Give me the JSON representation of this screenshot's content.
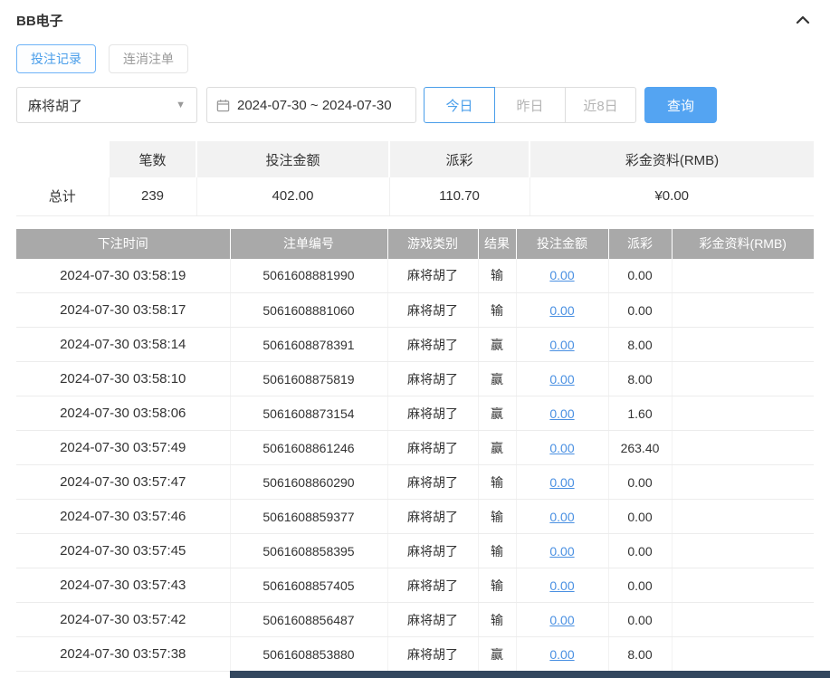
{
  "page": {
    "title": "BB电子"
  },
  "colors": {
    "accent": "#4a9eea",
    "search_button_bg": "#54a4f2",
    "table_header_bg": "#a9a9a9",
    "summary_header_bg": "#f2f2f2",
    "link": "#4a90e2",
    "bottom_bar": "#33475f"
  },
  "tabs": [
    {
      "label": "投注记录",
      "active": true
    },
    {
      "label": "连消注单",
      "active": false
    }
  ],
  "filters": {
    "game_select_value": "麻将胡了",
    "date_range": "2024-07-30 ~ 2024-07-30",
    "quick_buttons": [
      {
        "label": "今日",
        "active": true
      },
      {
        "label": "昨日",
        "active": false
      },
      {
        "label": "近8日",
        "active": false
      }
    ],
    "search_label": "查询"
  },
  "summary": {
    "headers": [
      "",
      "笔数",
      "投注金额",
      "派彩",
      "彩金资料(RMB)"
    ],
    "row": {
      "label": "总计",
      "count": "239",
      "bet_amount": "402.00",
      "payout": "110.70",
      "bonus": "¥0.00"
    }
  },
  "table": {
    "headers": [
      "下注时间",
      "注单编号",
      "游戏类别",
      "结果",
      "投注金额",
      "派彩",
      "彩金资料(RMB)"
    ],
    "rows": [
      [
        "2024-07-30 03:58:19",
        "5061608881990",
        "麻将胡了",
        "输",
        "0.00",
        "0.00",
        ""
      ],
      [
        "2024-07-30 03:58:17",
        "5061608881060",
        "麻将胡了",
        "输",
        "0.00",
        "0.00",
        ""
      ],
      [
        "2024-07-30 03:58:14",
        "5061608878391",
        "麻将胡了",
        "赢",
        "0.00",
        "8.00",
        ""
      ],
      [
        "2024-07-30 03:58:10",
        "5061608875819",
        "麻将胡了",
        "赢",
        "0.00",
        "8.00",
        ""
      ],
      [
        "2024-07-30 03:58:06",
        "5061608873154",
        "麻将胡了",
        "赢",
        "0.00",
        "1.60",
        ""
      ],
      [
        "2024-07-30 03:57:49",
        "5061608861246",
        "麻将胡了",
        "赢",
        "0.00",
        "263.40",
        ""
      ],
      [
        "2024-07-30 03:57:47",
        "5061608860290",
        "麻将胡了",
        "输",
        "0.00",
        "0.00",
        ""
      ],
      [
        "2024-07-30 03:57:46",
        "5061608859377",
        "麻将胡了",
        "输",
        "0.00",
        "0.00",
        ""
      ],
      [
        "2024-07-30 03:57:45",
        "5061608858395",
        "麻将胡了",
        "输",
        "0.00",
        "0.00",
        ""
      ],
      [
        "2024-07-30 03:57:43",
        "5061608857405",
        "麻将胡了",
        "输",
        "0.00",
        "0.00",
        ""
      ],
      [
        "2024-07-30 03:57:42",
        "5061608856487",
        "麻将胡了",
        "输",
        "0.00",
        "0.00",
        ""
      ],
      [
        "2024-07-30 03:57:38",
        "5061608853880",
        "麻将胡了",
        "赢",
        "0.00",
        "8.00",
        ""
      ]
    ]
  }
}
